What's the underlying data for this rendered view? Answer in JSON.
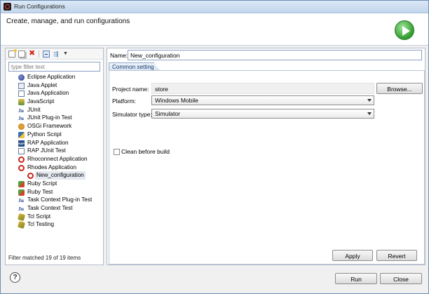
{
  "window": {
    "title": "Run Configurations"
  },
  "header": {
    "text": "Create, manage, and run configurations"
  },
  "sidebar": {
    "filter_placeholder": "type filter text",
    "items": [
      {
        "label": "Eclipse Application",
        "icon": "eclipse-icon"
      },
      {
        "label": "Java Applet",
        "icon": "java-applet-icon"
      },
      {
        "label": "Java Application",
        "icon": "java-app-icon"
      },
      {
        "label": "JavaScript",
        "icon": "javascript-icon"
      },
      {
        "label": "JUnit",
        "icon": "junit-icon"
      },
      {
        "label": "JUnit Plug-in Test",
        "icon": "junit-plugin-icon"
      },
      {
        "label": "OSGi Framework",
        "icon": "osgi-icon"
      },
      {
        "label": "Python Script",
        "icon": "python-icon"
      },
      {
        "label": "RAP Application",
        "icon": "rap-icon"
      },
      {
        "label": "RAP JUnit Test",
        "icon": "rap-junit-icon"
      },
      {
        "label": "Rhoconnect Application",
        "icon": "rhoconnect-icon"
      },
      {
        "label": "Rhodes Application",
        "icon": "rhodes-icon"
      },
      {
        "label": "New_configuration",
        "icon": "rhodes-config-icon",
        "selected": true
      },
      {
        "label": "Ruby Script",
        "icon": "ruby-icon"
      },
      {
        "label": "Ruby Test",
        "icon": "ruby-test-icon"
      },
      {
        "label": "Task Context Plug-in Test",
        "icon": "task-plugin-icon"
      },
      {
        "label": "Task Context Test",
        "icon": "task-test-icon"
      },
      {
        "label": "Tcl Script",
        "icon": "tcl-script-icon"
      },
      {
        "label": "Tcl Testing",
        "icon": "tcl-testing-icon"
      }
    ],
    "status": "Filter matched 19 of 19 items",
    "rap_icon_text": "RAP"
  },
  "config": {
    "name_label": "Name:",
    "name_value": "New_configuration",
    "tab_label": "Common setting",
    "project_label": "Project name:",
    "project_value": "store",
    "browse_label": "Browse...",
    "platform_label": "Platform:",
    "platform_value": "Windows Mobile",
    "simulator_label": "Simulator type:",
    "simulator_value": "Simulator",
    "clean_label": "Clean before build",
    "clean_checked": false,
    "apply_label": "Apply",
    "revert_label": "Revert"
  },
  "footer": {
    "help_label": "?",
    "run_label": "Run",
    "close_label": "Close"
  }
}
